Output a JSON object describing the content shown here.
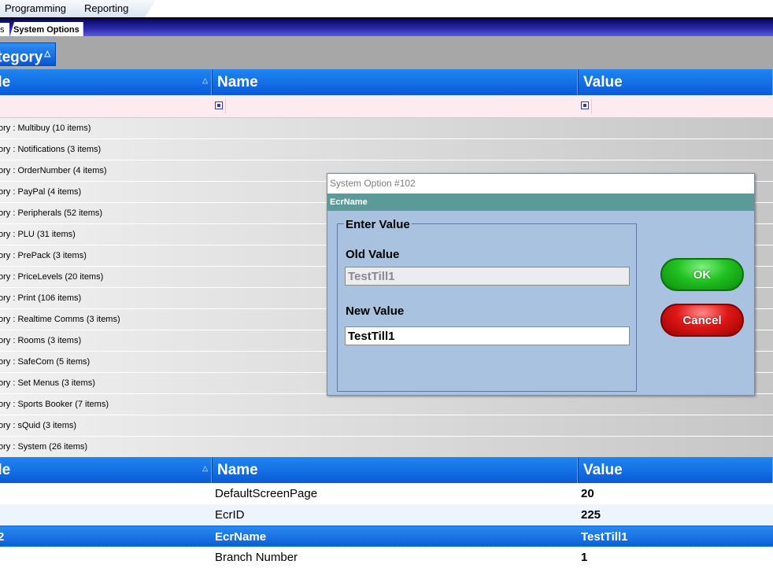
{
  "menu": {
    "items": [
      "Programming",
      "Reporting"
    ]
  },
  "tabs": {
    "prev_label": "s",
    "active_label": "System Options"
  },
  "group": {
    "label": "itegory",
    "sort_glyph": "△"
  },
  "columns": {
    "col1": "de",
    "col2": "Name",
    "col3": "Value",
    "sort_glyph": "△"
  },
  "groups": [
    "ory : Multibuy (10 items)",
    "ory : Notifications (3 items)",
    "ory : OrderNumber (4 items)",
    "ory : PayPal (4 items)",
    "ory : Peripherals (52 items)",
    "ory : PLU (31 items)",
    "ory : PrePack (3 items)",
    "ory : PriceLevels (20 items)",
    "ory : Print (106 items)",
    "ory : Realtime Comms (3 items)",
    "ory : Rooms (3 items)",
    "ory : SafeCom (5 items)",
    "ory : Set Menus (3 items)",
    "ory : Sports Booker (7 items)",
    "ory : sQuid (3 items)",
    "ory : System (26 items)"
  ],
  "rows": [
    {
      "lead": "",
      "name": "DefaultScreenPage",
      "value": "20"
    },
    {
      "lead": "",
      "name": "EcrID",
      "value": "225"
    },
    {
      "lead": "2",
      "name": "EcrName",
      "value": "TestTill1"
    },
    {
      "lead": "",
      "name": "Branch Number",
      "value": "1"
    }
  ],
  "dialog": {
    "title": "System Option #102",
    "subtitle": "EcrName",
    "legend": "Enter Value",
    "old_label": "Old Value",
    "old_value": "TestTill1",
    "new_label": "New Value",
    "new_value": "TestTill1",
    "ok_label": "OK",
    "cancel_label": "Cancel"
  }
}
